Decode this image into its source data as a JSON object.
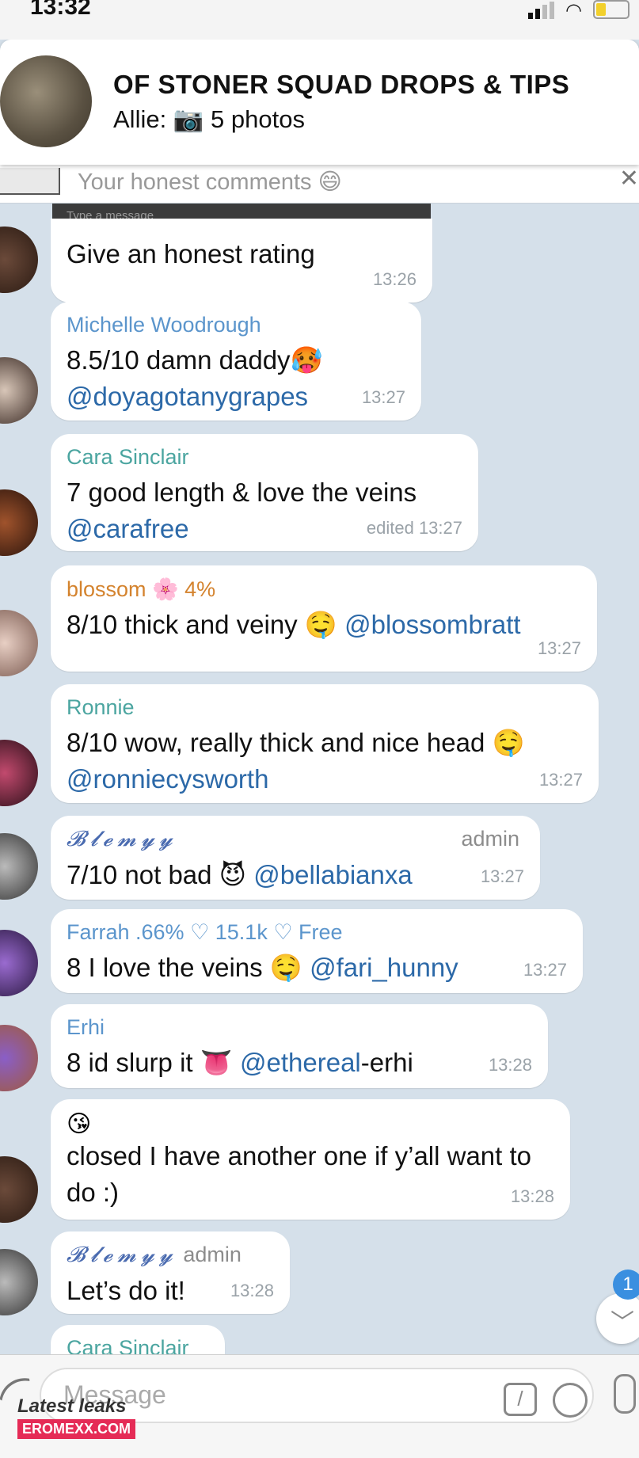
{
  "status": {
    "time": "13:32"
  },
  "header": {
    "title": "OF STONER SQUAD DROPS & TIPS",
    "subtitle": "Allie: 📷 5 photos"
  },
  "pinned": {
    "text": "Your honest comments 😄",
    "reply_placeholder": "Type a message"
  },
  "messages": [
    {
      "text": "Give an honest rating",
      "time": "13:26"
    },
    {
      "sender": "Michelle Woodrough",
      "text": "8.5/10 damn daddy🥵",
      "mention": "@doyagotanygrapes",
      "time": "13:27"
    },
    {
      "sender": "Cara Sinclair",
      "text": "7 good length & love the veins",
      "mention": "@carafree",
      "time": "edited 13:27"
    },
    {
      "sender": "blossom 🌸 4%",
      "text": "8/10 thick and veiny 🤤",
      "mention": "@blossombratt",
      "time": "13:27"
    },
    {
      "sender": "Ronnie",
      "text": "8/10 wow, really thick and nice head 🤤",
      "mention": "@ronniecysworth",
      "time": "13:27"
    },
    {
      "sender": "𝓑𝓵𝓮𝓶𝔂𝔂",
      "admin": "admin",
      "text": "7/10 not bad 😈",
      "mention": "@bellabianxa",
      "time": "13:27"
    },
    {
      "sender": "Farrah .66% ♡ 15.1k ♡ Free",
      "text": "8 I love the veins 🤤",
      "mention": "@fari_hunny",
      "time": "13:27"
    },
    {
      "sender": "Erhi",
      "text": "8 id slurp it 👅",
      "mention": "@ethereal",
      "text_after": "-erhi",
      "time": "13:28"
    },
    {
      "emoji": "😘",
      "text": "closed I have another one if y’all want to do :)",
      "time": "13:28"
    },
    {
      "sender": "𝓑𝓵𝓮𝓶𝔂𝔂",
      "admin": "admin",
      "text": "Let’s do it!",
      "time": "13:28"
    },
    {
      "sender": "Cara Sinclair"
    }
  ],
  "input": {
    "placeholder": "Message"
  },
  "unread_count": "1",
  "watermark": {
    "line1": "Latest leaks",
    "line2": "EROMEXX.COM"
  },
  "colors": {
    "sender_blue": "#5b95cc",
    "sender_teal": "#4ba5a0",
    "sender_orange": "#d4832e",
    "mention": "#2c69a8",
    "background": "#d5e0ea"
  }
}
